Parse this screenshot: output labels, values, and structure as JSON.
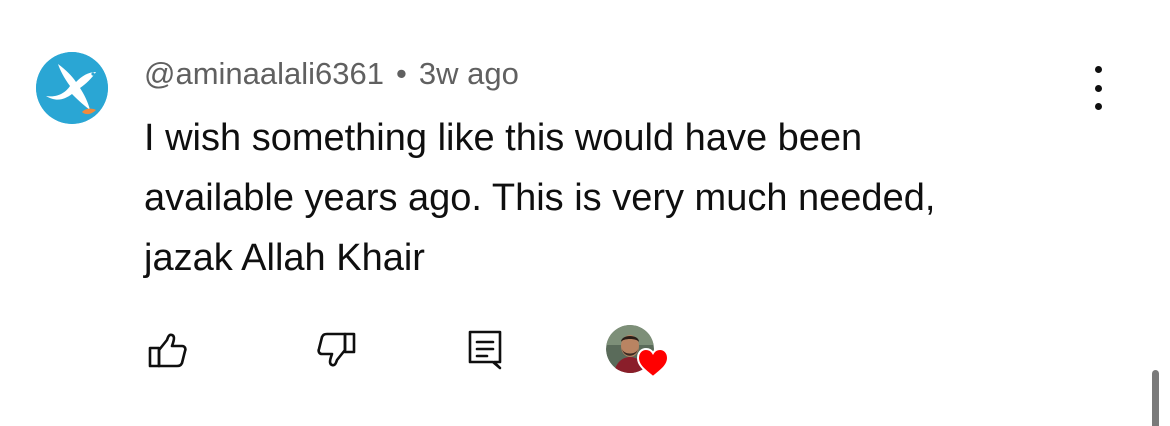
{
  "comment": {
    "author": "@aminaalali6361",
    "separator": "•",
    "timestamp": "3w ago",
    "text_lines": [
      "I wish something like this would have been",
      "available years ago. This is very much needed,",
      "jazak Allah Khair"
    ]
  },
  "avatar": {
    "icon": "bird-icon",
    "background": "#2aa6d4"
  },
  "actions": {
    "like_icon": "thumbs-up-icon",
    "dislike_icon": "thumbs-down-icon",
    "reply_icon": "reply-comment-icon",
    "creator_heart_icon": "heart-icon",
    "heart_color": "#ff0000"
  },
  "menu": {
    "icon": "more-vertical-icon"
  }
}
